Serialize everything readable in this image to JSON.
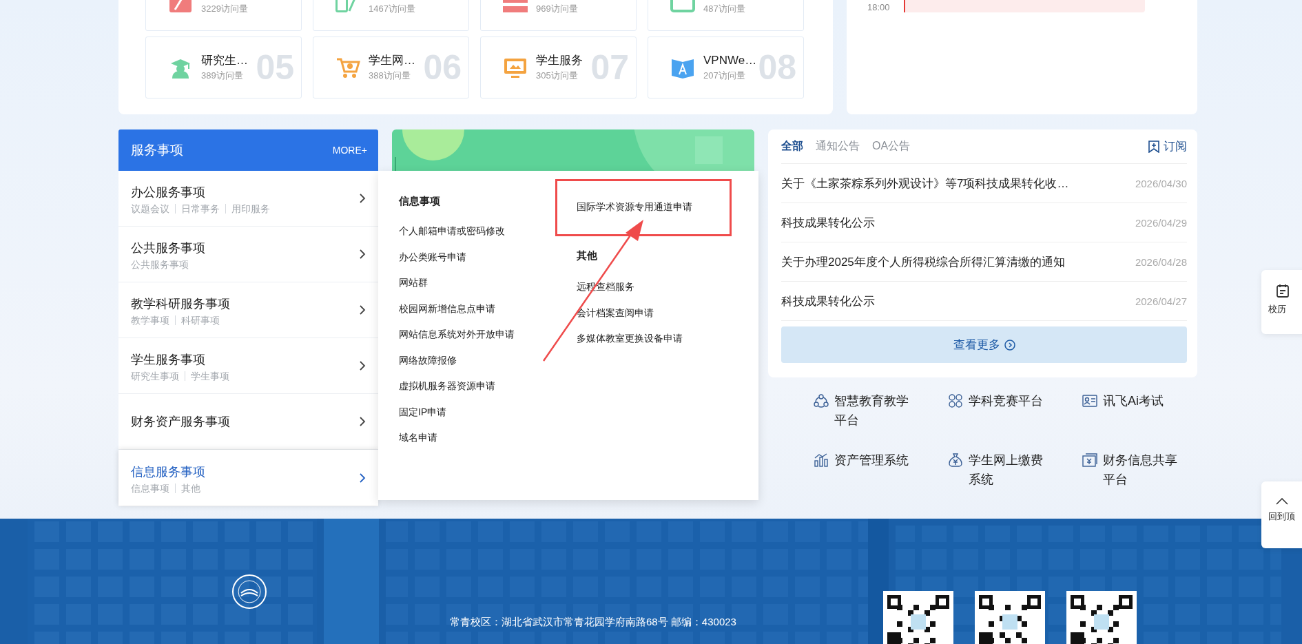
{
  "top_tiles": {
    "rows": [
      [
        {
          "visits": "3229访问量",
          "color": "#f07c7c"
        },
        {
          "visits": "1467访问量",
          "color": "#6fd3a0"
        },
        {
          "visits": "969访问量",
          "color": "#f07c7c"
        },
        {
          "visits": "487访问量",
          "color": "#6fd3a0"
        }
      ],
      [
        {
          "title": "研究生…",
          "visits": "389访问量",
          "number": "05",
          "color": "#6fd3a0"
        },
        {
          "title": "学生网…",
          "visits": "388访问量",
          "number": "06",
          "color": "#f4a340"
        },
        {
          "title": "学生服务",
          "visits": "305访问量",
          "number": "07",
          "color": "#f4a340"
        },
        {
          "title": "VPNWe…",
          "visits": "207访问量",
          "number": "08",
          "color": "#4aa3f0"
        }
      ]
    ]
  },
  "schedule": {
    "time": "18:00"
  },
  "services": {
    "title": "服务事项",
    "more": "MORE+",
    "categories": [
      {
        "title": "办公服务事项",
        "subs": [
          "议题会议",
          "日常事务",
          "用印服务"
        ],
        "selected": false
      },
      {
        "title": "公共服务事项",
        "subs": [
          "公共服务事项"
        ],
        "selected": false
      },
      {
        "title": "教学科研服务事项",
        "subs": [
          "教学事项",
          "科研事项"
        ],
        "selected": false
      },
      {
        "title": "学生服务事项",
        "subs": [
          "研究生事项",
          "学生事项"
        ],
        "selected": false
      },
      {
        "title": "财务资产服务事项",
        "selected": false
      },
      {
        "title": "信息服务事项",
        "subs": [
          "信息事项",
          "其他"
        ],
        "selected": true
      }
    ]
  },
  "dropdown": {
    "columns": [
      {
        "groups": [
          {
            "heading": "信息事项",
            "items": [
              "个人邮箱申请或密码修改",
              "办公类账号申请",
              "网站群",
              "校园网新增信息点申请",
              "网站信息系统对外开放申请",
              "网络故障报修",
              "虚拟机服务器资源申请",
              "固定IP申请",
              "域名申请"
            ]
          }
        ]
      },
      {
        "groups": [
          {
            "items": [
              "国际学术资源专用通道申请"
            ]
          },
          {
            "heading": "其他",
            "items": [
              "远程查档服务",
              "会计档案查阅申请",
              "多媒体教室更换设备申请"
            ]
          }
        ]
      }
    ]
  },
  "annotation": {
    "kind": "box-with-arrow"
  },
  "news": {
    "tabs": [
      {
        "label": "全部",
        "selected": true
      },
      {
        "label": "通知公告",
        "selected": false
      },
      {
        "label": "OA公告",
        "selected": false
      }
    ],
    "subscribe": "订阅",
    "items": [
      {
        "title": "关于《土家茶粽系列外观设计》等7项科技成果转化收…",
        "date": "2026/04/30"
      },
      {
        "title": "科技成果转化公示",
        "date": "2026/04/29"
      },
      {
        "title": "关于办理2025年度个人所得税综合所得汇算清缴的通知",
        "date": "2026/04/28"
      },
      {
        "title": "科技成果转化公示",
        "date": "2026/04/27"
      }
    ],
    "more": "查看更多"
  },
  "apps": [
    {
      "label": "智慧教育教学平台"
    },
    {
      "label": "学科竞赛平台"
    },
    {
      "label": "讯飞Ai考试"
    },
    {
      "label": "资产管理系统"
    },
    {
      "label": "学生网上缴费系统"
    },
    {
      "label": "财务信息共享平台"
    }
  ],
  "side_buttons": [
    {
      "label": "校历"
    },
    {
      "label": "回到顶"
    }
  ],
  "footer": {
    "address": "常青校区：湖北省武汉市常青花园学府南路68号 邮编：430023",
    "qr_codes": [
      {
        "kind": "qr"
      },
      {
        "kind": "qr"
      },
      {
        "kind": "qr"
      }
    ]
  }
}
